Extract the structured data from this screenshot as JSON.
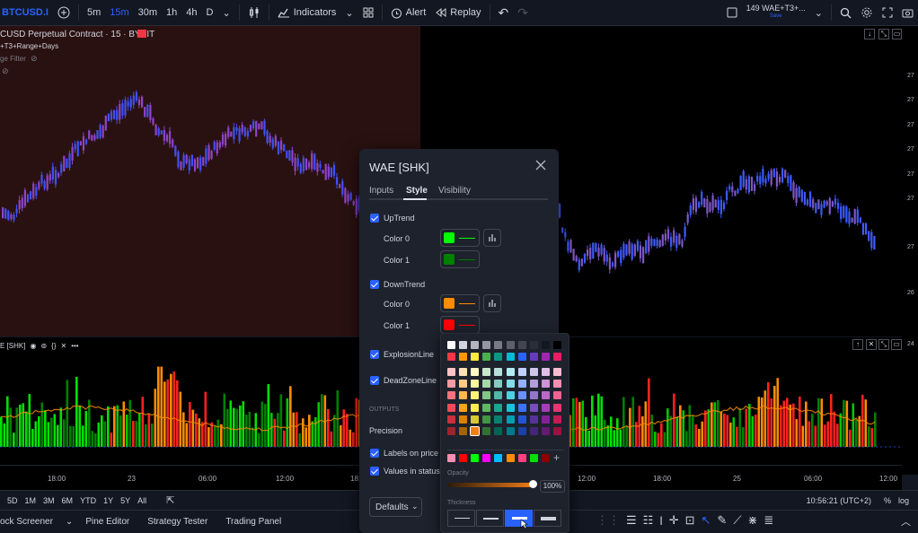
{
  "toolbar": {
    "symbol": "BTCUSD.I",
    "intervals": [
      "5m",
      "15m",
      "30m",
      "1h",
      "4h",
      "D"
    ],
    "active_interval": "15m",
    "indicators_label": "Indicators",
    "alert_label": "Alert",
    "replay_label": "Replay",
    "layout_name": "149 WAE+T3+...",
    "layout_status": "Save"
  },
  "legend": {
    "title": "CUSD Perpetual Contract · 15 · BYBIT",
    "indicator_line": "+T3+Range+Days",
    "filter_line": "ge Filter"
  },
  "indicator_pane": {
    "title": "E [SHK]"
  },
  "time_axis": {
    "labels": [
      "18:00",
      "23",
      "06:00",
      "12:00",
      "18:",
      "12:00",
      "18:00",
      "25",
      "06:00",
      "12:00"
    ]
  },
  "range_bar": {
    "ranges": [
      "5D",
      "1M",
      "3M",
      "6M",
      "YTD",
      "1Y",
      "5Y",
      "All"
    ],
    "clock": "10:56:21 (UTC+2)",
    "percent_label": "%",
    "log_label": "log"
  },
  "bottom_tabs": [
    "ock Screener",
    "Pine Editor",
    "Strategy Tester",
    "Trading Panel"
  ],
  "dialog": {
    "title": "WAE [SHK]",
    "tabs": [
      "Inputs",
      "Style",
      "Visibility"
    ],
    "active_tab": "Style",
    "uptrend_label": "UpTrend",
    "uptrend_color0_label": "Color 0",
    "uptrend_color1_label": "Color 1",
    "uptrend_color0": "#00ff00",
    "uptrend_color1": "#008000",
    "downtrend_label": "DownTrend",
    "downtrend_color0_label": "Color 0",
    "downtrend_color1_label": "Color 1",
    "downtrend_color0": "#ff8c00",
    "downtrend_color1": "#ff0000",
    "explosion_label": "ExplosionLine",
    "deadzone_label": "DeadZoneLine",
    "outputs_header": "OUTPUTS",
    "precision_label": "Precision",
    "labels_price_label": "Labels on price sc",
    "values_status_label": "Values in status li",
    "defaults_label": "Defaults"
  },
  "palette": {
    "opacity_label": "Opacity",
    "opacity_value": "100%",
    "thickness_label": "Thickness",
    "thickness_selected": 3,
    "selected_color": "#f57f17"
  },
  "price_axis_prefixes": [
    "27",
    "27",
    "27",
    "27",
    "27",
    "27",
    "27",
    "26",
    "24"
  ]
}
